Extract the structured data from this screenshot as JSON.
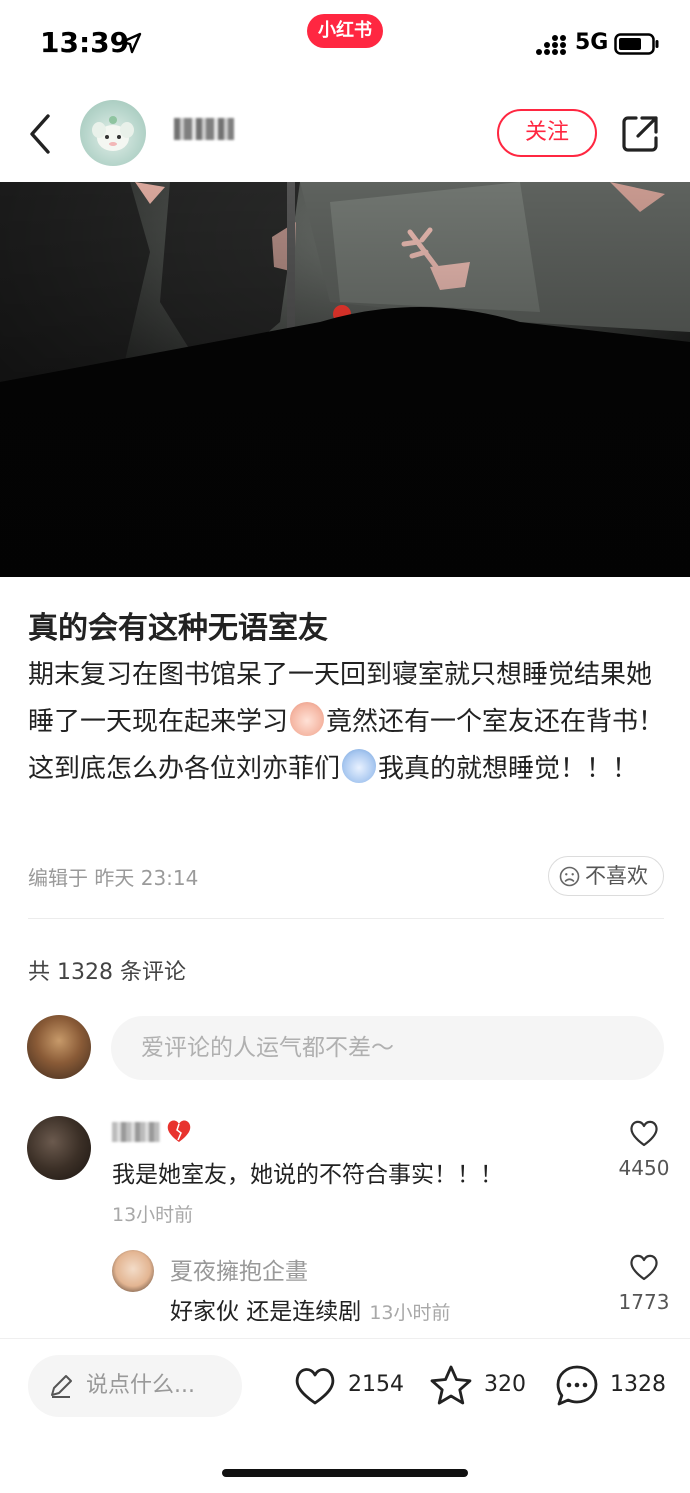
{
  "status_bar": {
    "time": "13:39",
    "app_badge": "小红书",
    "network": "5G"
  },
  "header": {
    "author_name": "用户",
    "follow_label": "关注"
  },
  "post": {
    "title": "真的会有这种无语室友",
    "body_part1": "期末复习在图书馆呆了一天回到寝室就只想睡觉结果她睡了一天现在起来学习",
    "body_part2": "竟然还有一个室友还在背书！这到底怎么办各位刘亦菲们",
    "body_part3": "我真的就想睡觉！！！",
    "edit_info": "编辑于 昨天 23:14",
    "dislike_label": "不喜欢"
  },
  "comments_section": {
    "total_label": "共 1328 条评论",
    "input_placeholder": "爱评论的人运气都不差～",
    "comments": [
      {
        "user": "用户",
        "text": "我是她室友，她说的不符合事实！！！",
        "time": "13小时前",
        "likes": "4450"
      }
    ],
    "replies": [
      {
        "user": "夏夜擁抱企畫",
        "text": "好家伙  还是连续剧",
        "time": "13小时前",
        "likes": "1773"
      }
    ]
  },
  "bottom_bar": {
    "input_placeholder": "说点什么...",
    "likes": "2154",
    "favorites": "320",
    "comments": "1328"
  },
  "colors": {
    "accent": "#ff2741",
    "muted": "#999999"
  },
  "icons": [
    "location-icon",
    "signal-icon",
    "battery-icon",
    "back-icon",
    "share-icon",
    "sad-face-icon",
    "heart-icon",
    "star-icon",
    "chat-bubble-icon",
    "pencil-icon"
  ]
}
